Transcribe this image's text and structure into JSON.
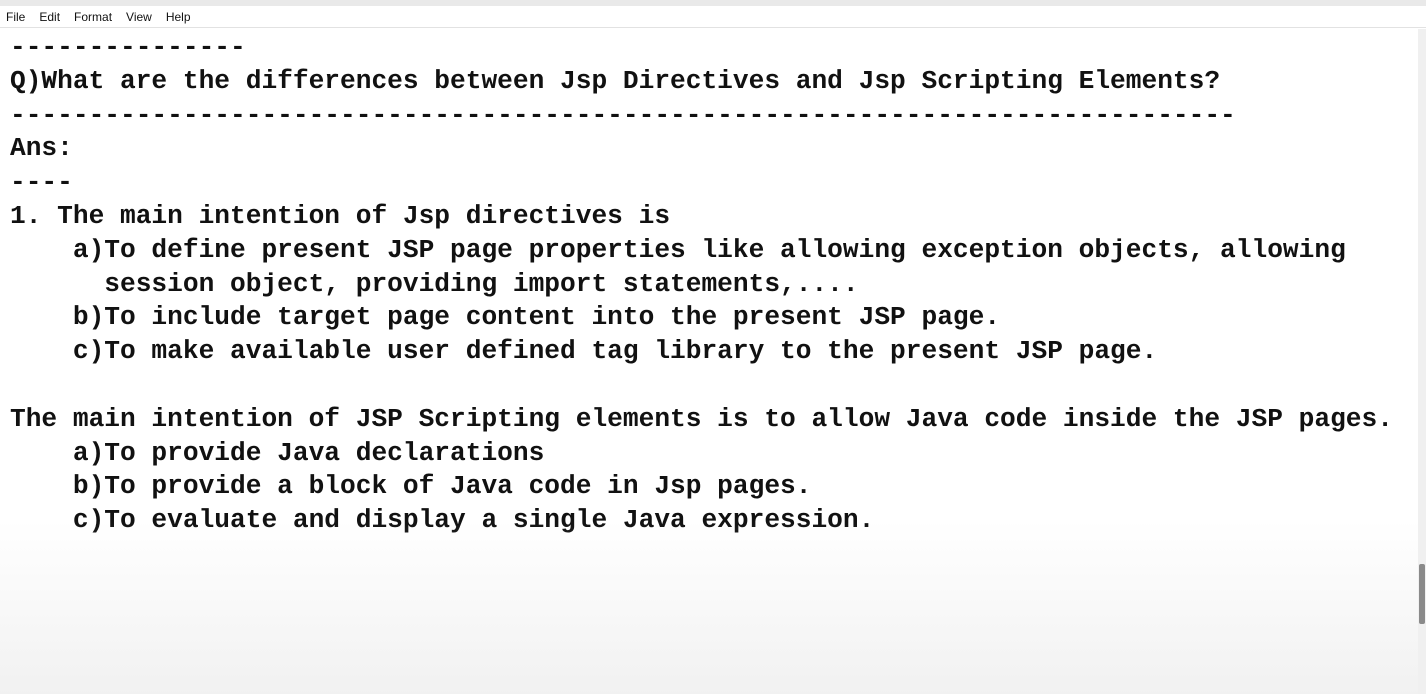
{
  "menu": {
    "items": [
      "File",
      "Edit",
      "Format",
      "View",
      "Help"
    ]
  },
  "document": {
    "lines": [
      "---------------",
      "Q)What are the differences between Jsp Directives and Jsp Scripting Elements?",
      "------------------------------------------------------------------------------",
      "Ans:",
      "----",
      "1. The main intention of Jsp directives is",
      "    a)To define present JSP page properties like allowing exception objects, allowing",
      "      session object, providing import statements,....",
      "    b)To include target page content into the present JSP page.",
      "    c)To make available user defined tag library to the present JSP page.",
      "",
      "The main intention of JSP Scripting elements is to allow Java code inside the JSP pages.",
      "    a)To provide Java declarations",
      "    b)To provide a block of Java code in Jsp pages.",
      "    c)To evaluate and display a single Java expression."
    ]
  }
}
